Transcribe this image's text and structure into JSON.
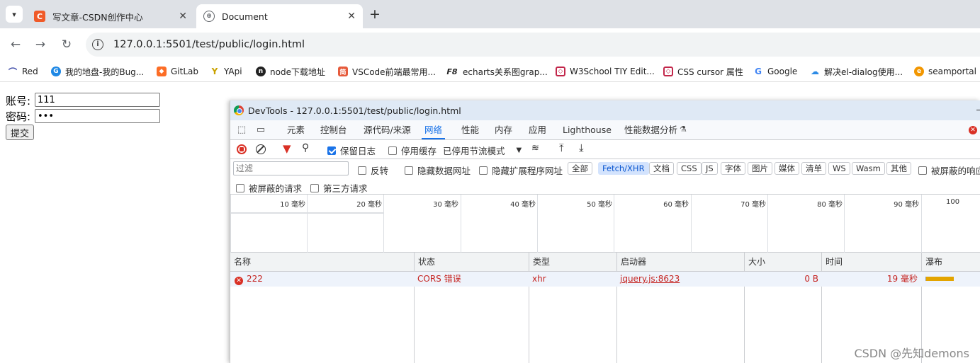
{
  "browser": {
    "tabs": [
      {
        "title": "写文章-CSDN创作中心",
        "active": false
      },
      {
        "title": "Document",
        "active": true
      }
    ],
    "new_tab_glyph": "+",
    "url": "127.0.0.1:5501/test/public/login.html",
    "bookmarks": [
      "Red",
      "我的地盘-我的Bug...",
      "GitLab",
      "YApi",
      "node下载地址",
      "VSCode前端最常用...",
      "echarts关系图grap...",
      "W3School TIY Edit...",
      "CSS cursor 属性",
      "Google",
      "解决el-dialog使用...",
      "seamportal"
    ]
  },
  "page": {
    "account_label": "账号:",
    "account_value": "111",
    "password_label": "密码:",
    "password_value": "•••",
    "submit_label": "提交"
  },
  "devtools": {
    "title": "DevTools - 127.0.0.1:5501/test/public/login.html",
    "tabs": [
      "元素",
      "控制台",
      "源代码/来源",
      "网络",
      "性能",
      "内存",
      "应用",
      "Lighthouse",
      "性能数据分析"
    ],
    "active_tab": "网络",
    "actions": {
      "preserve_log": "保留日志",
      "disable_cache": "停用缓存",
      "throttle": "已停用节流模式"
    },
    "filter": {
      "placeholder": "过滤",
      "invert": "反转",
      "hide_data_urls": "隐藏数据网址",
      "hide_extension_urls": "隐藏扩展程序网址",
      "types": [
        "全部",
        "Fetch/XHR",
        "文档",
        "CSS",
        "JS",
        "字体",
        "图片",
        "媒体",
        "清单",
        "WS",
        "Wasm",
        "其他"
      ],
      "active_type": "Fetch/XHR",
      "blocked_response": "被屏蔽的响应",
      "blocked_requests": "被屏蔽的请求",
      "third_party": "第三方请求"
    },
    "timeline_ticks": [
      "10 毫秒",
      "20 毫秒",
      "30 毫秒",
      "40 毫秒",
      "50 毫秒",
      "60 毫秒",
      "70 毫秒",
      "80 毫秒",
      "90 毫秒",
      "100"
    ],
    "columns": [
      "名称",
      "状态",
      "类型",
      "启动器",
      "大小",
      "时间",
      "瀑布"
    ],
    "rows": [
      {
        "name": "222",
        "status": "CORS 错误",
        "type": "xhr",
        "initiator": "jquery.js:8623",
        "size": "0 B",
        "time": "19 毫秒"
      }
    ]
  },
  "watermark": "CSDN @先知demons",
  "colors": {
    "accent": "#1a73e8",
    "error": "#c5221f",
    "waterfall_bar": "#e3a400"
  }
}
